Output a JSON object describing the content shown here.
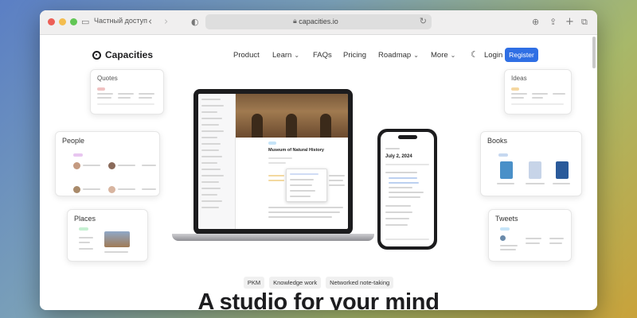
{
  "browser": {
    "tab_label": "Частный доступ",
    "url": "capacities.io",
    "icons": [
      "sidebar-icon",
      "back-icon",
      "forward-icon",
      "privacy-shield-icon",
      "lock-icon",
      "reload-icon",
      "download-icon",
      "share-icon",
      "new-tab-icon",
      "tabs-overview-icon"
    ]
  },
  "nav": {
    "brand": "Capacities",
    "items": [
      {
        "label": "Product",
        "dropdown": false
      },
      {
        "label": "Learn",
        "dropdown": true
      },
      {
        "label": "FAQs",
        "dropdown": false
      },
      {
        "label": "Pricing",
        "dropdown": false
      },
      {
        "label": "Roadmap",
        "dropdown": true
      },
      {
        "label": "More",
        "dropdown": true
      }
    ],
    "login": "Login",
    "register": "Register",
    "accent": "#2f6fe4"
  },
  "cards": {
    "quotes": "Quotes",
    "ideas": "Ideas",
    "people": "People",
    "books": "Books",
    "places": "Places",
    "tweets": "Tweets"
  },
  "preview": {
    "laptop_title": "Museum of Natural History",
    "phone_date": "July 2, 2024"
  },
  "hero": {
    "tags": [
      "PKM",
      "Knowledge work",
      "Networked note-taking"
    ],
    "headline": "A studio for your mind"
  }
}
